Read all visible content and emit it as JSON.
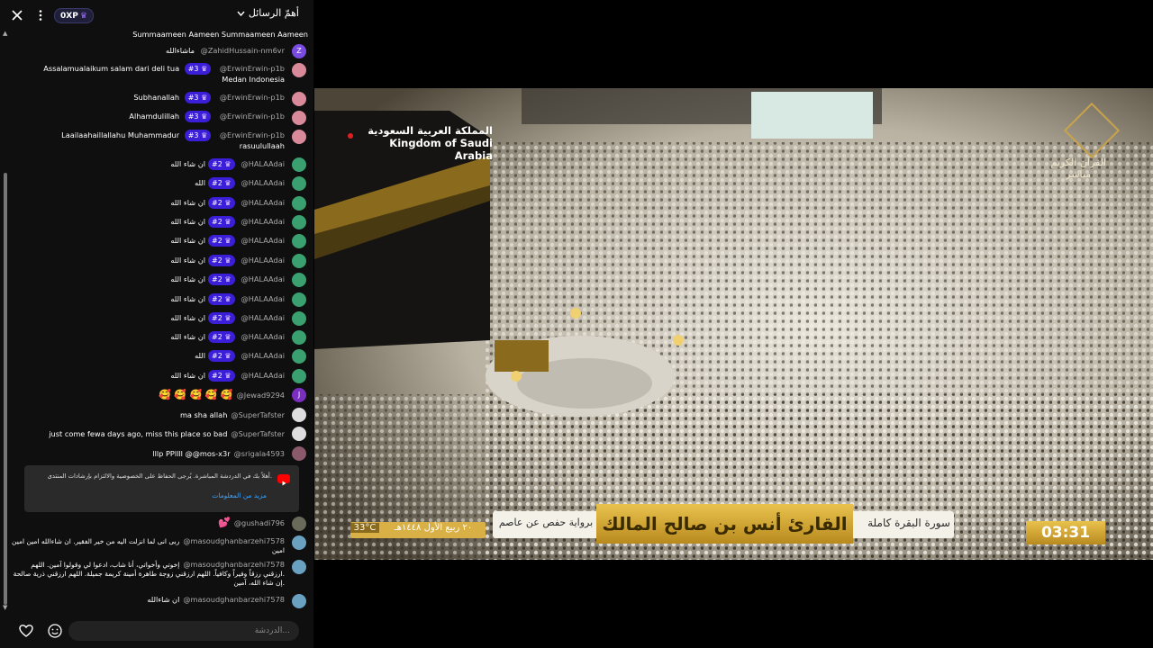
{
  "header": {
    "xp": "0XP",
    "title": "أهمّ الرسائل"
  },
  "messages": [
    {
      "author": "",
      "text": "Summaameen Aameen Summaameen Aameen",
      "badge": ""
    },
    {
      "author": "@ZahidHussain-nm6vr",
      "text": "ماشاءالله",
      "badge": "",
      "avatar_letter": "Z"
    },
    {
      "author": "@ErwinErwin-p1b",
      "text": "Assalamualaikum salam dari deli tua",
      "text2": "Medan Indonesia",
      "badge": "#3"
    },
    {
      "author": "@ErwinErwin-p1b",
      "text": "Subhanallah",
      "badge": "#3"
    },
    {
      "author": "@ErwinErwin-p1b",
      "text": "Alhamdulillah",
      "badge": "#3"
    },
    {
      "author": "@ErwinErwin-p1b",
      "text": "Laailaahaillallahu Muhammadur",
      "text2": "rasuulullaah",
      "badge": "#3"
    },
    {
      "author": "@HALAAdai",
      "text": "ان شاء الله",
      "badge": "#2"
    },
    {
      "author": "@HALAAdai",
      "text": "الله",
      "badge": "#2"
    },
    {
      "author": "@HALAAdai",
      "text": "ان شاء الله",
      "badge": "#2"
    },
    {
      "author": "@HALAAdai",
      "text": "ان شاء الله",
      "badge": "#2"
    },
    {
      "author": "@HALAAdai",
      "text": "ان شاء الله",
      "badge": "#2"
    },
    {
      "author": "@HALAAdai",
      "text": "ان شاء الله",
      "badge": "#2"
    },
    {
      "author": "@HALAAdai",
      "text": "ان شاء الله",
      "badge": "#2"
    },
    {
      "author": "@HALAAdai",
      "text": "ان شاء الله",
      "badge": "#2"
    },
    {
      "author": "@HALAAdai",
      "text": "ان شاء الله",
      "badge": "#2"
    },
    {
      "author": "@HALAAdai",
      "text": "ان شاء الله",
      "badge": "#2"
    },
    {
      "author": "@HALAAdai",
      "text": "الله",
      "badge": "#2"
    },
    {
      "author": "@HALAAdai",
      "text": "ان شاء الله",
      "badge": "#2"
    },
    {
      "author": "@Jewad9294",
      "text": "🥰 🥰 🥰 🥰 🥰",
      "badge": "",
      "avatar_letter": "J"
    },
    {
      "author": "@SuperTafster",
      "text": "ma sha allah",
      "badge": ""
    },
    {
      "author": "@SuperTafster",
      "text": "just come fewa days ago, miss this place so bad",
      "badge": ""
    },
    {
      "author": "@srigala4593",
      "text": "lllp PPllll @@mos-x3r",
      "badge": ""
    },
    {
      "author": "@gushadi796",
      "text": "💕",
      "badge": ""
    },
    {
      "author": "@masoudghanbarzehi7578",
      "text": "ربی انی لما انزلت الیه من خیر الفقیر. ان شاءالله امین امین",
      "text2": "امین",
      "badge": ""
    },
    {
      "author": "@masoudghanbarzehi7578",
      "text": "إخوتي وأخواتي، أنا شاب، ادعوا لي وقولوا آمين. اللهم",
      "text2": "ارزقني رزقاً وفيراً وكافياً. اللهم ارزقني زوجة طاهرة أمينة كريمة جميلة. اللهم ارزقني ذرية صالحة.",
      "text3": "إن شاء الله، آمين.",
      "badge": ""
    },
    {
      "author": "@masoudghanbarzehi7578",
      "text": "ان شاءالله",
      "badge": ""
    }
  ],
  "notice": {
    "text": "أهلاً بك في الدردشة المباشرة. يُرجى الحفاظ على الخصوصية والالتزام بإرشادات المنتدى.",
    "link": "مزيد من المعلومات"
  },
  "input": {
    "placeholder": "الدردشة..."
  },
  "video": {
    "channel_ar": "المملكة العربية السعودية",
    "channel_en": "Kingdom of Saudi Arabia",
    "logo_text": "القرآن الكريم",
    "live_text": "مباشر",
    "surah": "سورة البقرة كاملة",
    "reciter": "القارئ أنس بن صالح المالك",
    "riwaya": "برواية حفص عن عاصم",
    "date": "٢٠ ربيع الأول ١٤٤٨هـ",
    "temp": "33°C",
    "time": "03:31"
  },
  "colors": {
    "chat_bg": "#0f0f0f",
    "badge": "#3b1fd8",
    "gold": "#d4a62a"
  }
}
